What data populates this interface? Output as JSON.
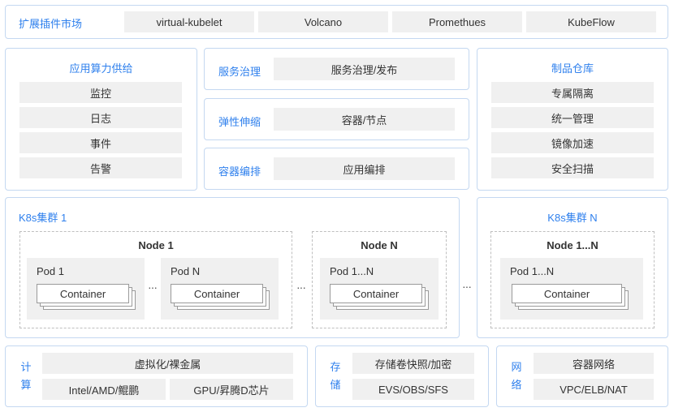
{
  "extensions": {
    "title": "扩展插件市场",
    "items": [
      "virtual-kubelet",
      "Volcano",
      "Promethues",
      "KubeFlow"
    ]
  },
  "app_compute": {
    "title": "应用算力供给",
    "items": [
      "监控",
      "日志",
      "事件",
      "告警"
    ]
  },
  "middle_rows": [
    {
      "title": "服务治理",
      "value": "服务治理/发布"
    },
    {
      "title": "弹性伸缩",
      "value": "容器/节点"
    },
    {
      "title": "容器编排",
      "value": "应用编排"
    }
  ],
  "artifact": {
    "title": "制品仓库",
    "items": [
      "专属隔离",
      "统一管理",
      "镜像加速",
      "安全扫描"
    ]
  },
  "cluster1": {
    "title": "K8s集群 1",
    "node1": {
      "title": "Node 1",
      "pods": [
        {
          "label": "Pod 1",
          "container": "Container"
        },
        {
          "label": "Pod N",
          "container": "Container"
        }
      ]
    },
    "nodeN": {
      "title": "Node N",
      "pod": {
        "label": "Pod 1...N",
        "container": "Container"
      }
    }
  },
  "clusterN": {
    "title": "K8s集群 N",
    "node": {
      "title": "Node 1...N",
      "pod": {
        "label": "Pod 1...N",
        "container": "Container"
      }
    }
  },
  "ellipsis": "···",
  "compute": {
    "label_chars": [
      "计",
      "算"
    ],
    "top": "虚拟化/裸金属",
    "bottom_left": "Intel/AMD/鲲鹏",
    "bottom_right": "GPU/昇腾D芯片"
  },
  "storage": {
    "label_chars": [
      "存",
      "储"
    ],
    "top": "存储卷快照/加密",
    "bottom": "EVS/OBS/SFS"
  },
  "network": {
    "label_chars": [
      "网",
      "络"
    ],
    "top": "容器网络",
    "bottom": "VPC/ELB/NAT"
  },
  "colors": {
    "accent": "#2f80ed",
    "border": "#c4d8f1",
    "cell": "#f0f0f0"
  }
}
